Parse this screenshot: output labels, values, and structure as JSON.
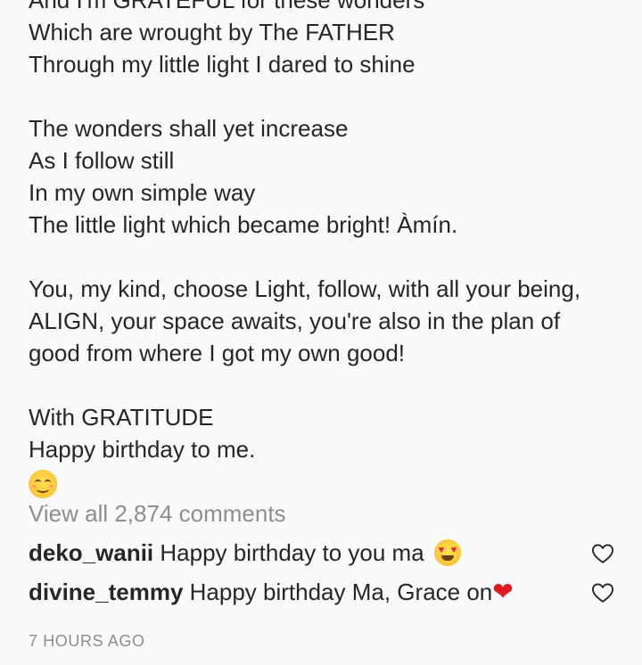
{
  "caption": {
    "lines_a": [
      "And I'm GRATEFUL for these wonders",
      "Which are wrought by The FATHER",
      "Through my little light I dared to shine"
    ],
    "lines_b": [
      "The wonders shall yet increase",
      "As I follow still",
      "In my own simple way",
      "The little light which became bright! Àmín."
    ],
    "paragraph_c": "You, my kind, choose Light, follow, with all your being, ALIGN, your space awaits, you're also in the plan of good from where I got my own good!",
    "lines_d": [
      "With GRATITUDE",
      "Happy birthday to me."
    ],
    "closing_emoji": "smiling-face-with-smiling-eyes"
  },
  "view_all_comments": "View all 2,874 comments",
  "comments": [
    {
      "username": "deko_wanii",
      "text": "Happy birthday to you ma",
      "emoji": "smiling-face-with-heart-eyes",
      "like_icon": "heart-outline-icon"
    },
    {
      "username": "divine_temmy",
      "text": "Happy birthday Ma, Grace on",
      "emoji": "red-heart",
      "like_icon": "heart-outline-icon"
    }
  ],
  "timestamp": "7 HOURS AGO",
  "colors": {
    "background": "#fafafa",
    "text": "#262626",
    "muted": "#8e8e8e",
    "heart_red": "#e0171d"
  }
}
